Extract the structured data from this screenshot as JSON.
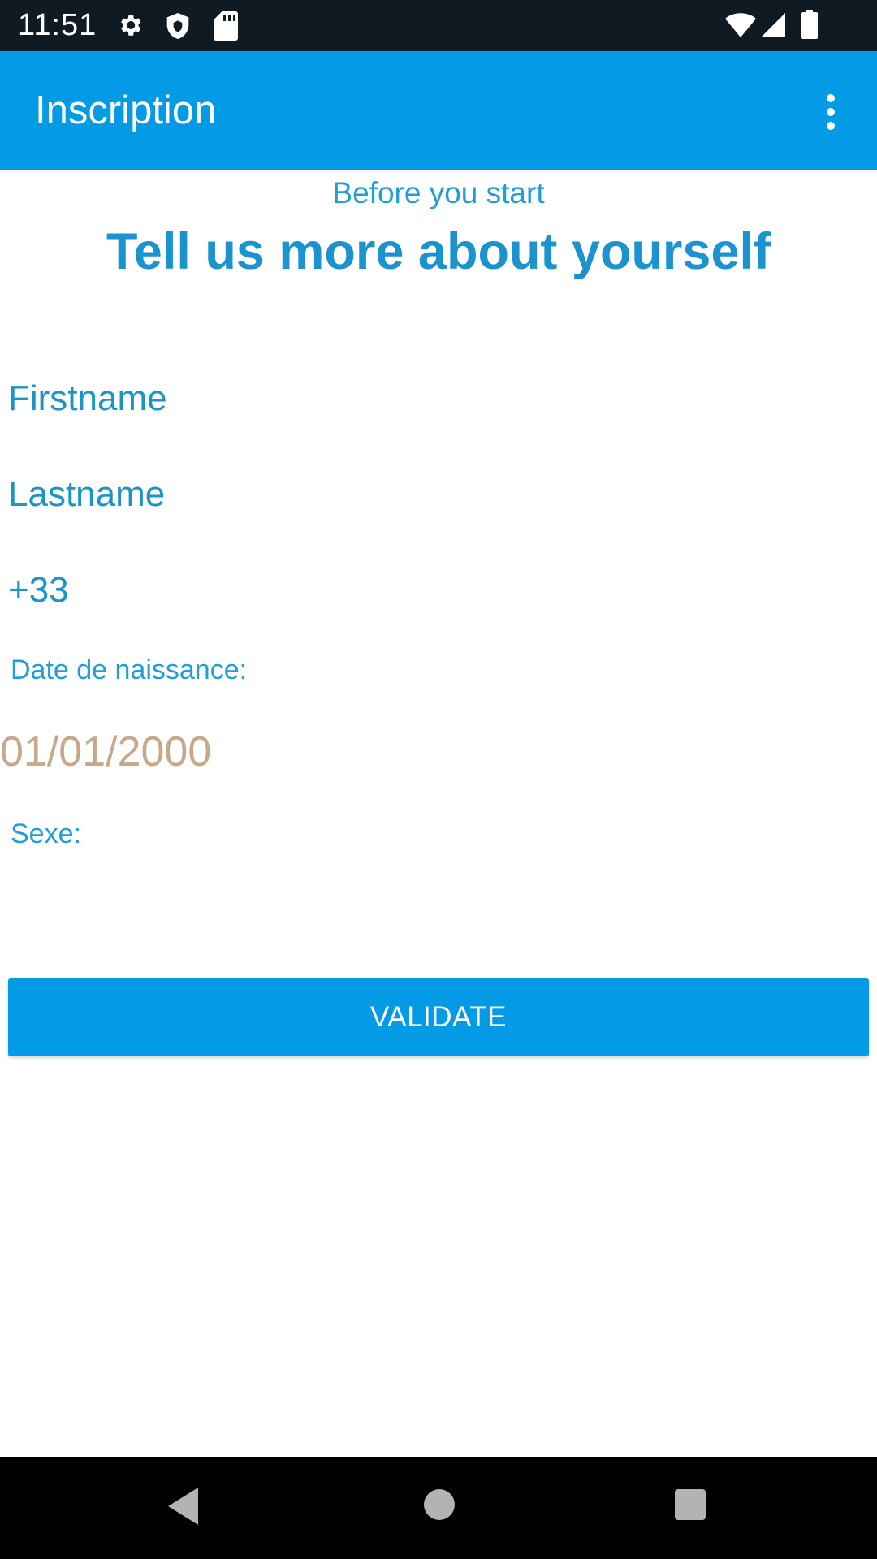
{
  "status_bar": {
    "time": "11:51",
    "icons": [
      "gear-icon",
      "shield-icon",
      "sd-card-icon",
      "wifi-icon",
      "signal-icon",
      "battery-icon"
    ]
  },
  "app_bar": {
    "title": "Inscription",
    "menu_icon": "more-vert-icon",
    "background": "#039be5"
  },
  "header": {
    "subtitle": "Before you start",
    "headline": "Tell us more about yourself"
  },
  "form": {
    "firstname_placeholder": "Firstname",
    "lastname_placeholder": "Lastname",
    "phone_value": "+33",
    "birthdate_label": "Date de naissance:",
    "birthdate_value": "01/01/2000",
    "sex_label": "Sexe:",
    "validate_label": "VALIDATE"
  },
  "nav_bar": {
    "buttons": [
      "back-icon",
      "home-icon",
      "recents-icon"
    ]
  },
  "colors": {
    "accent": "#039be5",
    "text_blue": "#1e9fd6",
    "date_text": "#c7a88a"
  }
}
